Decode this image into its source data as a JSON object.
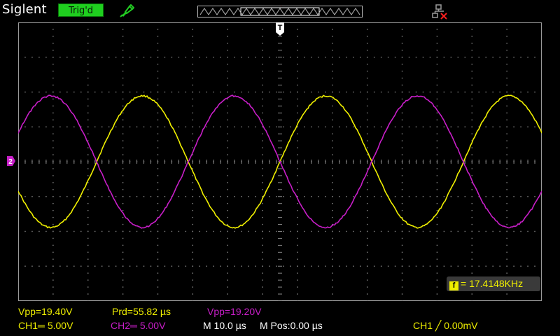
{
  "header": {
    "brand": "Siglent",
    "trigger_status": "Trig'd"
  },
  "colors": {
    "ch1": "#f0f000",
    "ch2": "#c81ec8",
    "trigger_badge": "#1fcf1f",
    "grid": "#8a8a8a"
  },
  "icons": {
    "probe": "probe-icon",
    "network": "network-disconnected-icon",
    "trigger_position": "trigger-position-icon",
    "channel_marker": "ch2-offset-marker-icon",
    "frequency": "frequency-icon"
  },
  "measurements": {
    "ch1_vpp": "Vpp=19.40V",
    "prd": "Prd=55.82 µs",
    "ch2_vpp": "Vpp=19.20V",
    "frequency": "= 17.4148KHz"
  },
  "channels": {
    "ch1_scale": "CH1═ 5.00V",
    "ch2_scale": "CH2═ 5.00V"
  },
  "timebase": {
    "main": "M 10.0 µs",
    "position": "M Pos:0.00 µs"
  },
  "trigger": {
    "label": "CH1 ╱ 0.00mV"
  },
  "memory_marker": "T",
  "ch_marker_label": "2"
}
